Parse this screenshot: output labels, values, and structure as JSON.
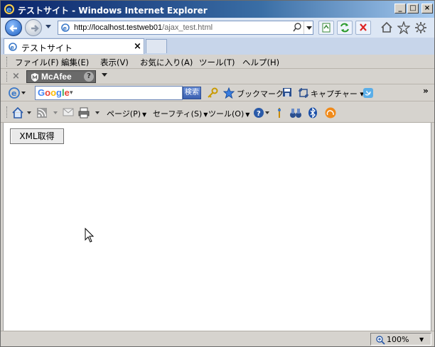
{
  "window": {
    "title": "テストサイト - Windows Internet Explorer"
  },
  "address_bar": {
    "url_host": "http://localhost.testweb01",
    "url_path": "/ajax_test.html"
  },
  "tab": {
    "label": "テストサイト",
    "close": "×"
  },
  "menu": [
    "ファイル(F)",
    "編集(E)",
    "表示(V)",
    "お気に入り(A)",
    "ツール(T)",
    "ヘルプ(H)"
  ],
  "mcafee": {
    "label": "McAfee",
    "help": "?"
  },
  "google_toolbar": {
    "logo": "Google",
    "search_button": "検索",
    "bookmark": "ブックマーク",
    "capture": "キャプチャー",
    "more": "»"
  },
  "command_bar": {
    "page": "ページ(P)",
    "safety": "セーフティ(S)",
    "tools": "ツール(O)"
  },
  "content": {
    "xml_button": "XML取得"
  },
  "status": {
    "zoom": "100%"
  },
  "colors": {
    "titlebar_start": "#0a246a",
    "titlebar_end": "#a6caf0",
    "toolbar_bg": "#d6d3ce",
    "google_blue": "#4285f4"
  }
}
